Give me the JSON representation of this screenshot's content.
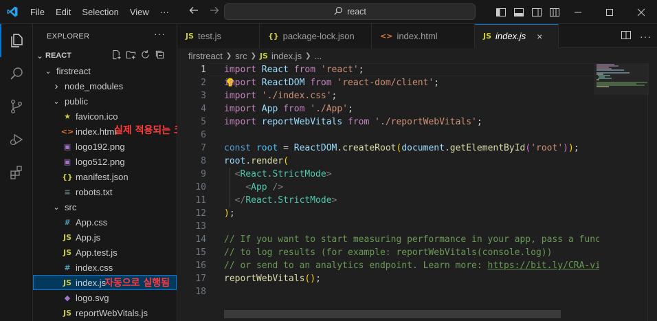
{
  "menu": {
    "items": [
      "File",
      "Edit",
      "Selection",
      "View",
      "···"
    ],
    "search_text": "react"
  },
  "icons": {
    "logo": "vscode-logo-icon",
    "back": "arrow-left-icon",
    "forward": "arrow-right-icon",
    "search": "search-icon"
  },
  "sidebar": {
    "title": "EXPLORER",
    "more": "···",
    "section": "REACT",
    "tree": [
      {
        "label": "firstreact",
        "type": "folder-open",
        "depth": 1
      },
      {
        "label": "node_modules",
        "type": "folder-closed",
        "depth": 2
      },
      {
        "label": "public",
        "type": "folder-open",
        "depth": 2
      },
      {
        "label": "favicon.ico",
        "type": "file-star",
        "depth": 3
      },
      {
        "label": "index.html",
        "type": "file-html",
        "depth": 3
      },
      {
        "label": "logo192.png",
        "type": "file-image",
        "depth": 3
      },
      {
        "label": "logo512.png",
        "type": "file-image",
        "depth": 3
      },
      {
        "label": "manifest.json",
        "type": "file-json",
        "depth": 3
      },
      {
        "label": "robots.txt",
        "type": "file-txt",
        "depth": 3
      },
      {
        "label": "src",
        "type": "folder-open",
        "depth": 2
      },
      {
        "label": "App.css",
        "type": "file-css",
        "depth": 3
      },
      {
        "label": "App.js",
        "type": "file-js",
        "depth": 3
      },
      {
        "label": "App.test.js",
        "type": "file-js",
        "depth": 3
      },
      {
        "label": "index.css",
        "type": "file-css",
        "depth": 3
      },
      {
        "label": "index.js",
        "type": "file-js",
        "depth": 3,
        "selected": true
      },
      {
        "label": "logo.svg",
        "type": "file-svg",
        "depth": 3
      },
      {
        "label": "reportWebVitals.js",
        "type": "file-js",
        "depth": 3
      }
    ],
    "annotation_html": "실제 적용되는 코드",
    "annotation_js": "자동으로 실행됨"
  },
  "tabs": [
    {
      "label": "test.js",
      "icon": "JS",
      "active": false
    },
    {
      "label": "package-lock.json",
      "icon": "{}",
      "active": false
    },
    {
      "label": "index.html",
      "icon": "<>",
      "active": false
    },
    {
      "label": "index.js",
      "icon": "JS",
      "active": true,
      "close": "×"
    }
  ],
  "breadcrumb": [
    "firstreact",
    "src",
    "index.js",
    "..."
  ],
  "breadcrumb_icon": "JS",
  "editor": {
    "current_line": 1,
    "line_numbers": [
      "1",
      "2",
      "3",
      "4",
      "5",
      "6",
      "7",
      "8",
      "9",
      "10",
      "11",
      "12",
      "13",
      "14",
      "15",
      "16",
      "17",
      "18"
    ]
  },
  "colors": {
    "accent": "#0078d4",
    "annotation": "#ff3b3b",
    "js_icon": "#f1e05a",
    "css_icon": "#519aba",
    "html_icon": "#e37933",
    "json_icon": "#cbcb41",
    "image_icon": "#a074c4"
  }
}
